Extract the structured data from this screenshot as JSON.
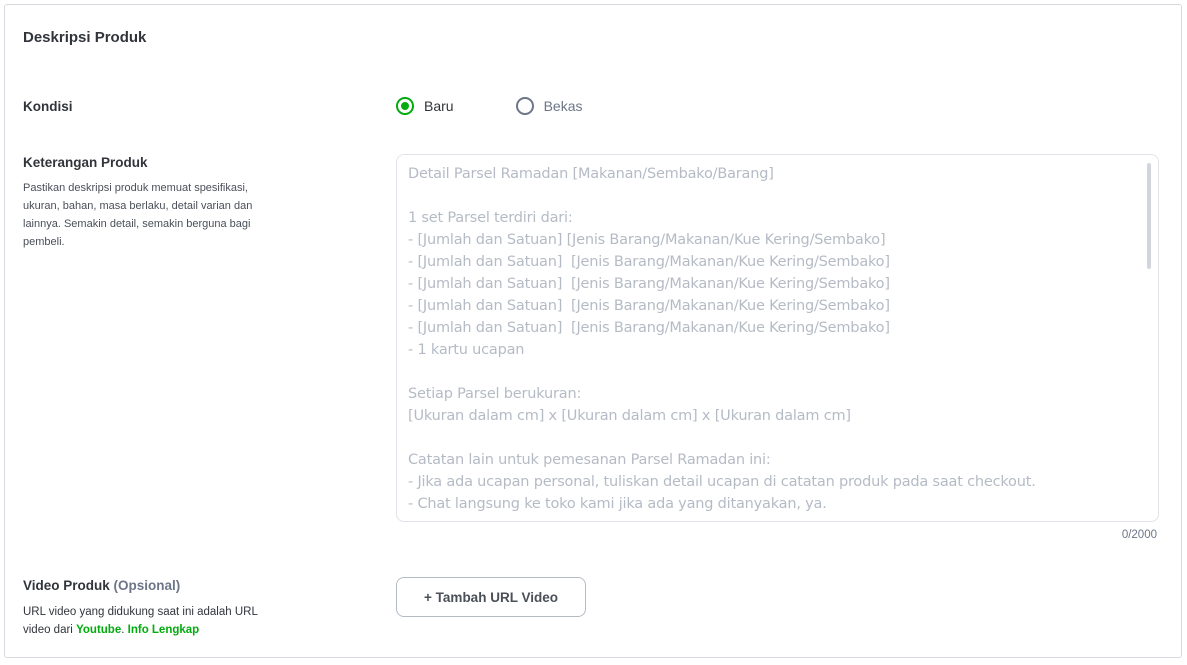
{
  "section": {
    "title": "Deskripsi Produk"
  },
  "kondisi": {
    "label": "Kondisi",
    "options": [
      {
        "label": "Baru",
        "selected": true
      },
      {
        "label": "Bekas",
        "selected": false
      }
    ]
  },
  "keterangan": {
    "label": "Keterangan Produk",
    "help": "Pastikan deskripsi produk memuat spesifikasi, ukuran, bahan, masa berlaku, detail varian dan lainnya. Semakin detail, semakin berguna bagi pembeli.",
    "value": "",
    "placeholder": "Detail Parsel Ramadan [Makanan/Sembako/Barang]\n\n1 set Parsel terdiri dari:\n- [Jumlah dan Satuan] [Jenis Barang/Makanan/Kue Kering/Sembako]\n- [Jumlah dan Satuan]  [Jenis Barang/Makanan/Kue Kering/Sembako]\n- [Jumlah dan Satuan]  [Jenis Barang/Makanan/Kue Kering/Sembako]\n- [Jumlah dan Satuan]  [Jenis Barang/Makanan/Kue Kering/Sembako]\n- [Jumlah dan Satuan]  [Jenis Barang/Makanan/Kue Kering/Sembako]\n- 1 kartu ucapan\n\nSetiap Parsel berukuran:\n[Ukuran dalam cm] x [Ukuran dalam cm] x [Ukuran dalam cm]\n\nCatatan lain untuk pemesanan Parsel Ramadan ini:\n- Jika ada ucapan personal, tuliskan detail ucapan di catatan produk pada saat checkout.\n- Chat langsung ke toko kami jika ada yang ditanyakan, ya.",
    "counter": "0/2000"
  },
  "video": {
    "label": "Video Produk",
    "optional": "(Opsional)",
    "help_text": "URL video yang didukung saat ini adalah URL video dari",
    "youtube_link": "Youtube",
    "separator": ".",
    "info_link": "Info Lengkap",
    "button_label": "+ Tambah URL Video"
  },
  "colors": {
    "accent": "#03ac0e",
    "text": "#31353b",
    "muted": "#6d7588",
    "placeholder": "#b5bbc5"
  }
}
